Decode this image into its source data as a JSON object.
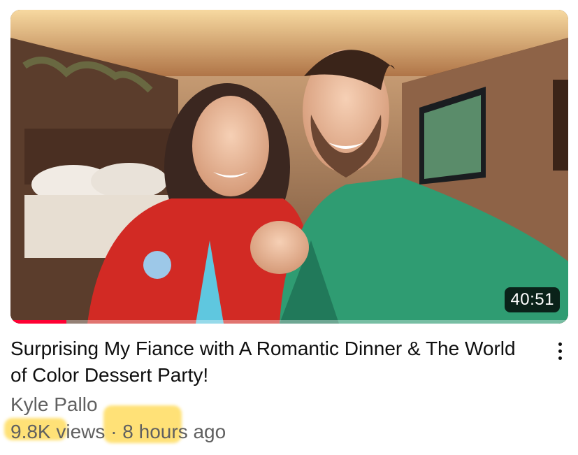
{
  "video": {
    "duration": "40:51",
    "watch_progress_fraction": 0.1,
    "title": "Surprising My Fiance with A Romantic Dinner & The World of Color Dessert Party!",
    "channel": "Kyle Pallo",
    "views": "9.8K views",
    "separator": "·",
    "age": "8 hours ago"
  },
  "colors": {
    "progress": "#ff0033",
    "highlight": "#ffd84a",
    "title_text": "#0f0f0f",
    "meta_text": "#606060"
  },
  "icons": {
    "more": "more-vertical-icon"
  }
}
